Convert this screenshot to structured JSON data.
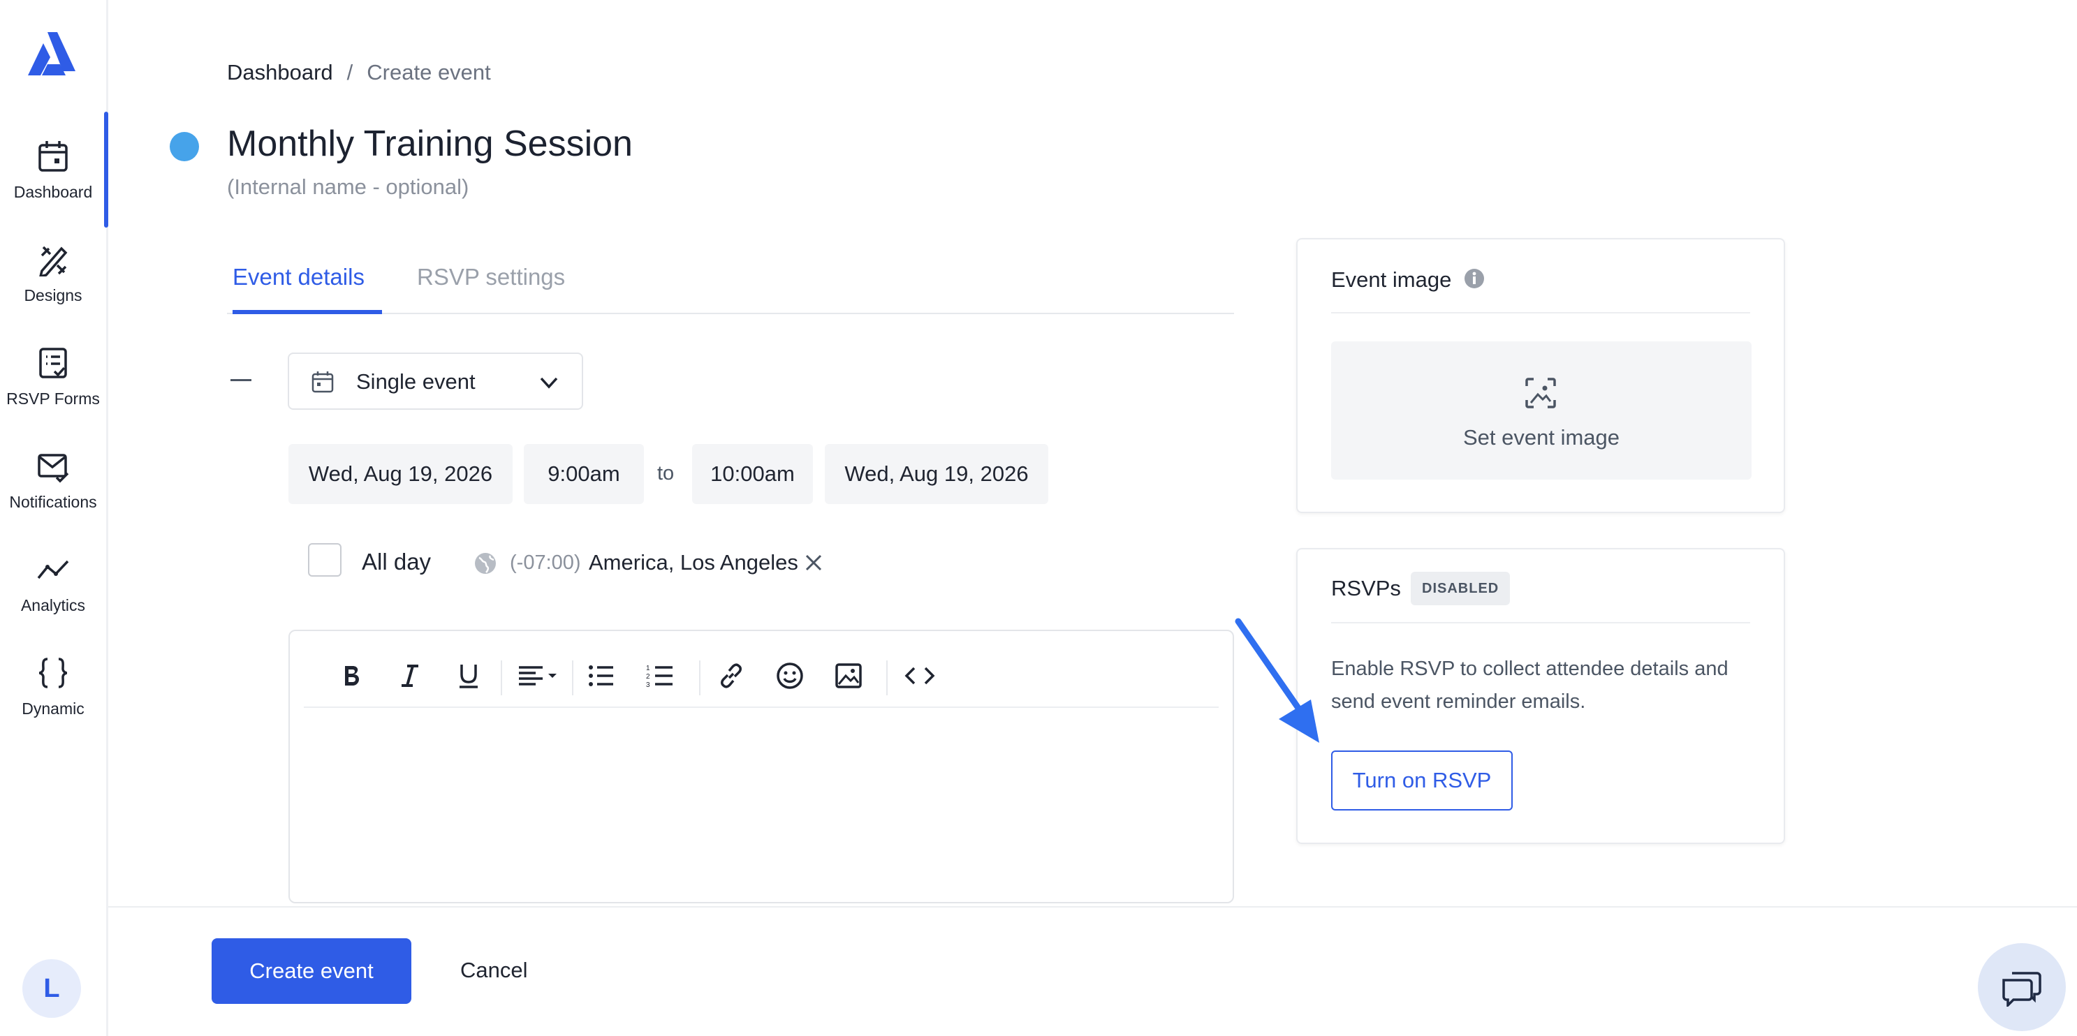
{
  "sidebar": {
    "items": [
      {
        "label": "Dashboard",
        "icon": "calendar-icon"
      },
      {
        "label": "Designs",
        "icon": "design-tools-icon"
      },
      {
        "label": "RSVP Forms",
        "icon": "form-check-icon"
      },
      {
        "label": "Notifications",
        "icon": "mail-check-icon"
      },
      {
        "label": "Analytics",
        "icon": "trend-line-icon"
      },
      {
        "label": "Dynamic",
        "icon": "curly-braces-icon"
      }
    ],
    "avatar_initial": "L",
    "accent_color": "#2f5ce6"
  },
  "breadcrumb": {
    "root": "Dashboard",
    "separator": "/",
    "current": "Create event"
  },
  "event": {
    "title": "Monthly Training Session",
    "subtitle": "(Internal name - optional)",
    "status_color": "#46a3ea"
  },
  "tabs": [
    {
      "label": "Event details",
      "active": true
    },
    {
      "label": "RSVP settings",
      "active": false
    }
  ],
  "schedule": {
    "event_type": "Single event",
    "start_date": "Wed, Aug 19, 2026",
    "start_time": "9:00am",
    "to_label": "to",
    "end_time": "10:00am",
    "end_date": "Wed, Aug 19, 2026",
    "all_day_label": "All day",
    "all_day_checked": false,
    "timezone_offset": "(-07:00)",
    "timezone_name": "America, Los Angeles"
  },
  "editor": {
    "toolbar": [
      "bold-icon",
      "italic-icon",
      "underline-icon",
      "align-icon",
      "bullet-list-icon",
      "numbered-list-icon",
      "link-icon",
      "emoji-icon",
      "image-icon",
      "code-icon"
    ]
  },
  "event_image": {
    "title": "Event image",
    "set_label": "Set event image"
  },
  "rsvps": {
    "title": "RSVPs",
    "badge": "DISABLED",
    "description": "Enable RSVP to collect attendee details and send event reminder emails.",
    "button": "Turn on RSVP"
  },
  "footer": {
    "create_label": "Create event",
    "cancel_label": "Cancel"
  }
}
